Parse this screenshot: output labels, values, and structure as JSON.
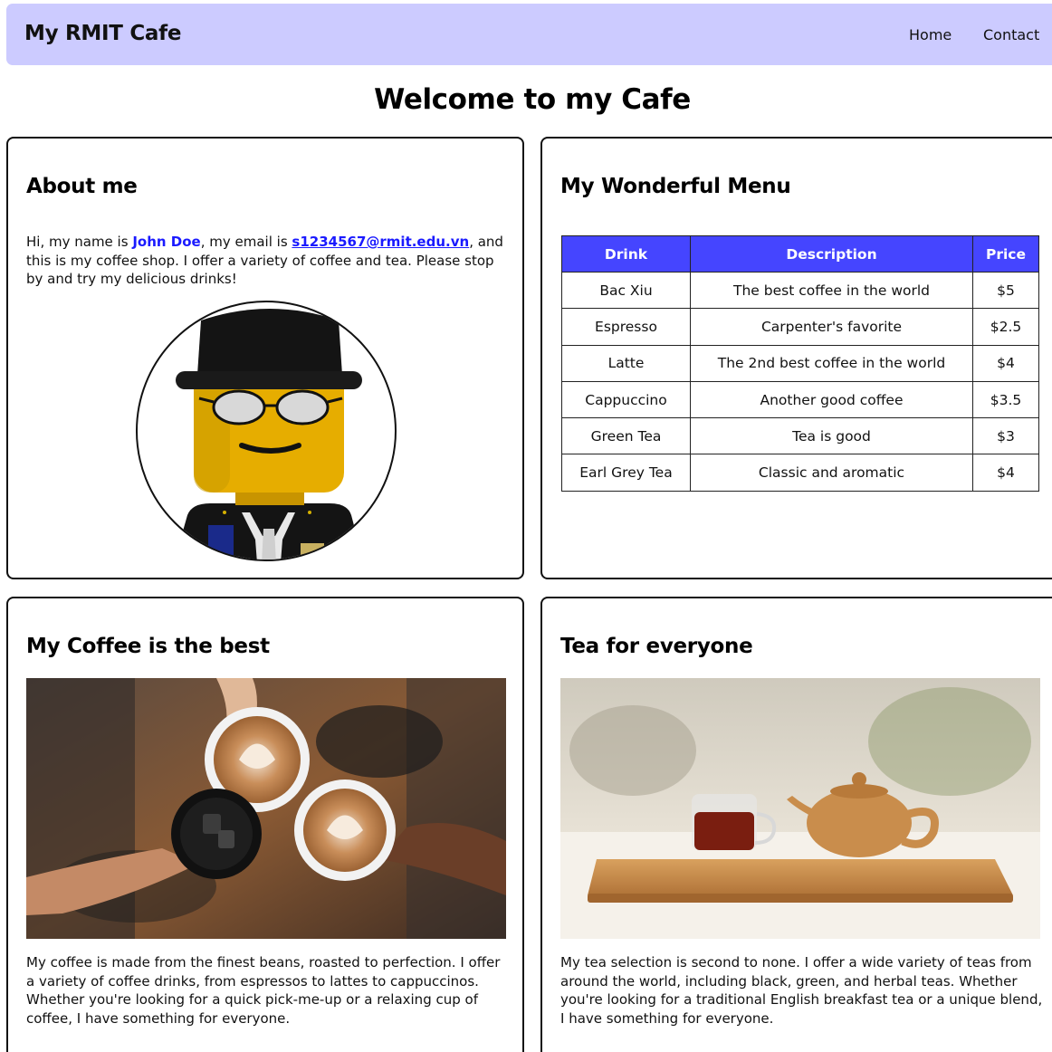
{
  "nav": {
    "brand": "My RMIT Cafe",
    "links": [
      "Home",
      "Contact"
    ]
  },
  "page_title": "Welcome to my Cafe",
  "about": {
    "title": "About me",
    "text_before_name": "Hi, my name is ",
    "name": "John Doe",
    "text_before_email": ", my email is ",
    "email": "s1234567@rmit.edu.vn",
    "text_after_email": ", and this is my coffee shop. I offer a variety of coffee and tea. Please stop by and try my delicious drinks!",
    "avatar_alt": "lego-minifigure-avatar"
  },
  "menu": {
    "title": "My Wonderful Menu",
    "headers": [
      "Drink",
      "Description",
      "Price"
    ],
    "rows": [
      [
        "Bac Xiu",
        "The best coffee in the world",
        "$5"
      ],
      [
        "Espresso",
        "Carpenter's favorite",
        "$2.5"
      ],
      [
        "Latte",
        "The 2nd best coffee in the world",
        "$4"
      ],
      [
        "Cappuccino",
        "Another good coffee",
        "$3.5"
      ],
      [
        "Green Tea",
        "Tea is good",
        "$3"
      ],
      [
        "Earl Grey Tea",
        "Classic and aromatic",
        "$4"
      ]
    ],
    "header_color": "#4545ff"
  },
  "coffee": {
    "title": "My Coffee is the best",
    "text": "My coffee is made from the finest beans, roasted to perfection. I offer a variety of coffee drinks, from espressos to lattes to cappuccinos. Whether you're looking for a quick pick-me-up or a relaxing cup of coffee, I have something for everyone."
  },
  "tea": {
    "title": "Tea for everyone",
    "text": "My tea selection is second to none. I offer a wide variety of teas from around the world, including black, green, and herbal teas. Whether you're looking for a traditional English breakfast tea or a unique blend, I have something for everyone."
  },
  "colors": {
    "navbar": "#cccbff",
    "link": "#1a1aff",
    "table_header": "#4545ff"
  }
}
